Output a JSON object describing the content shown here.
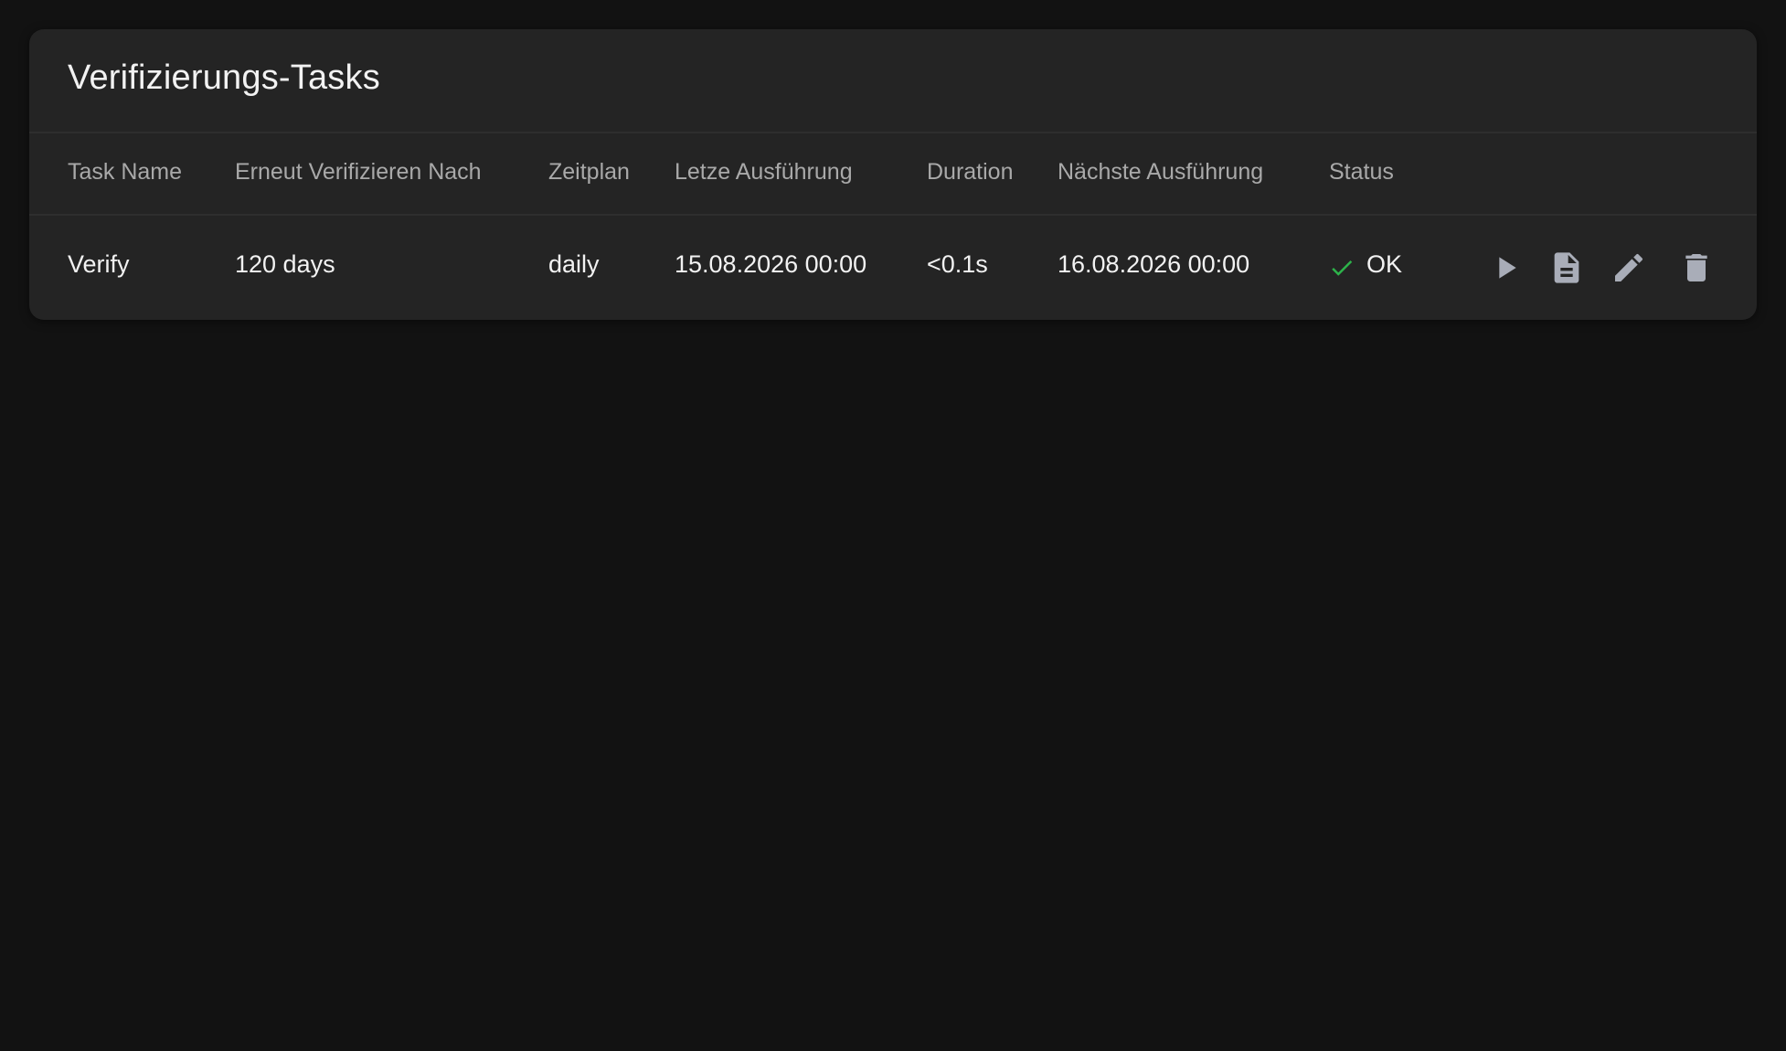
{
  "card": {
    "title": "Verifizierungs-Tasks"
  },
  "table": {
    "columns": [
      "Task Name",
      "Erneut Verifizieren Nach",
      "Zeitplan",
      "Letze Ausführung",
      "Duration",
      "Nächste Ausführung",
      "Status"
    ],
    "rows": [
      {
        "task_name": "Verify",
        "reverify_after": "120 days",
        "schedule": "daily",
        "last_run": "15.08.2026 00:00",
        "duration": "<0.1s",
        "next_run": "16.08.2026 00:00",
        "status": "OK",
        "status_icon": "check-icon",
        "actions": [
          "play-icon",
          "document-icon",
          "pencil-icon",
          "trash-icon"
        ]
      }
    ]
  },
  "colors": {
    "background": "#121212",
    "card": "#242424",
    "status_ok": "#2db34a",
    "icon": "#a9adb8"
  }
}
